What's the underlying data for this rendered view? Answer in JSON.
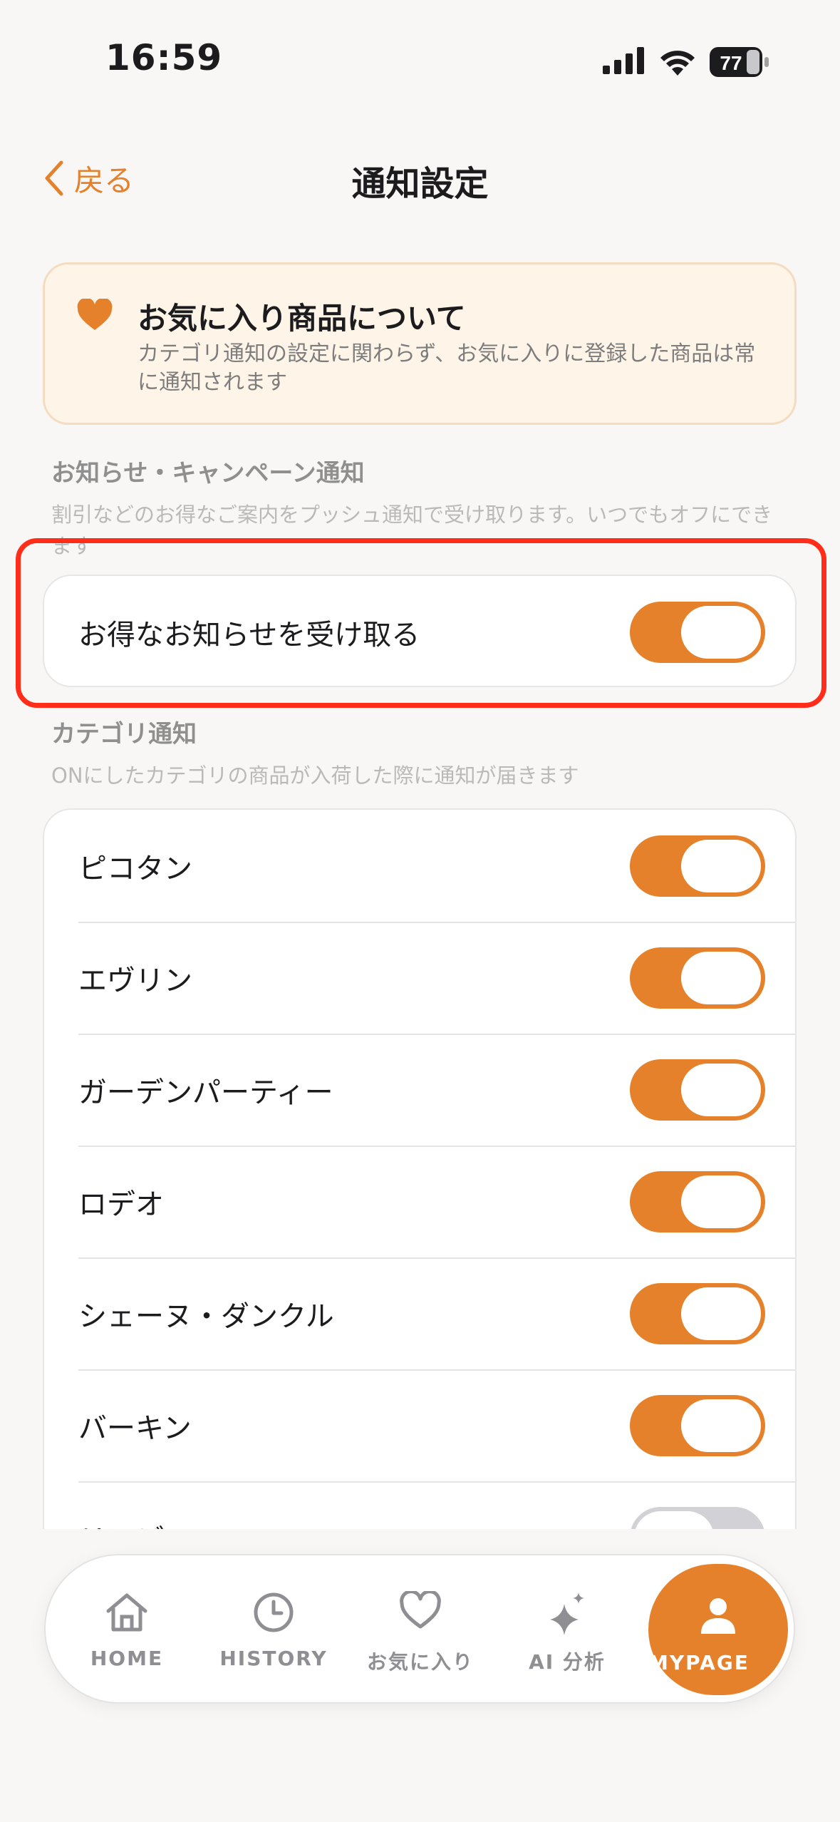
{
  "status_bar": {
    "time": "16:59",
    "battery": "77"
  },
  "nav": {
    "back_label": "戻る",
    "title": "通知設定"
  },
  "favorites_notice": {
    "title": "お気に入り商品について",
    "description": "カテゴリ通知の設定に関わらず、お気に入りに登録した商品は常に通知されます"
  },
  "campaign": {
    "title": "お知らせ・キャンペーン通知",
    "description": "割引などのお得なご案内をプッシュ通知で受け取ります。いつでもオフにできます",
    "row": {
      "label": "お得なお知らせを受け取る",
      "on": true
    }
  },
  "category": {
    "title": "カテゴリ通知",
    "description": "ONにしたカテゴリの商品が入荷した際に通知が届きます",
    "items": [
      {
        "label": "ピコタン",
        "on": true
      },
      {
        "label": "エヴリン",
        "on": true
      },
      {
        "label": "ガーデンパーティー",
        "on": true
      },
      {
        "label": "ロデオ",
        "on": true
      },
      {
        "label": "シェーヌ・ダンクル",
        "on": true
      },
      {
        "label": "バーキン",
        "on": true
      },
      {
        "label": "リンディ",
        "on": false
      }
    ]
  },
  "tabbar": {
    "tabs": [
      {
        "label": "HOME",
        "icon": "home-icon"
      },
      {
        "label": "HISTORY",
        "icon": "clock-icon"
      },
      {
        "label": "お気に入り",
        "icon": "heart-icon"
      },
      {
        "label": "AI 分析",
        "icon": "sparkles-icon"
      },
      {
        "label": "MYPAGE",
        "icon": "person-icon",
        "active": true
      }
    ]
  },
  "colors": {
    "accent": "#e5812a",
    "highlight": "#ff2d1a",
    "background": "#f8f7f5"
  }
}
